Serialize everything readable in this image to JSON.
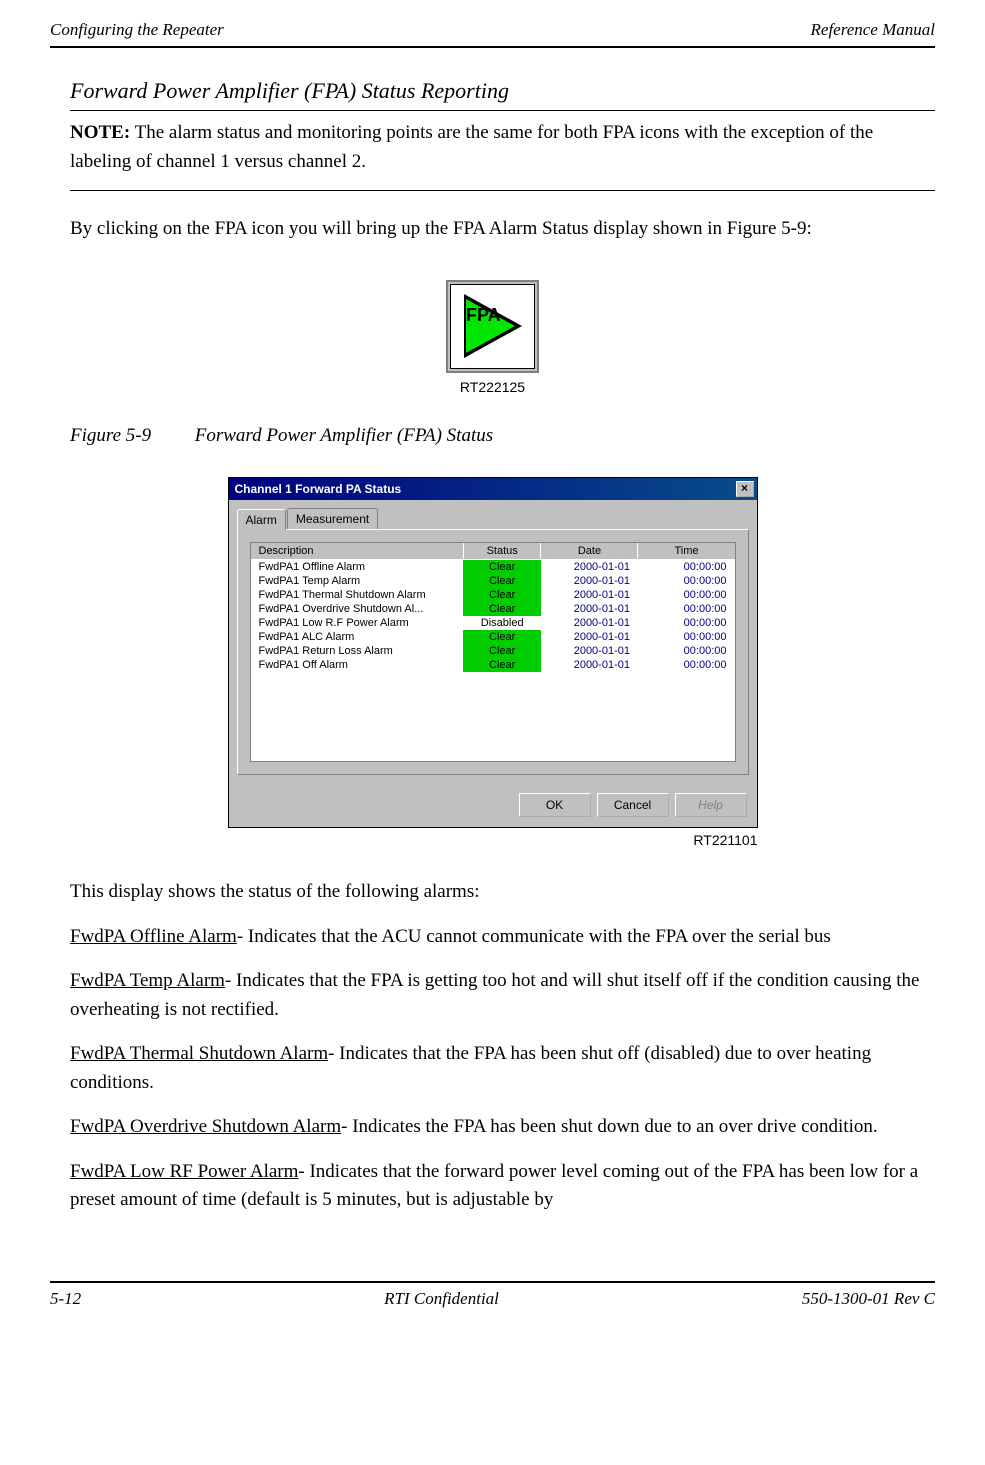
{
  "header": {
    "left": "Configuring the Repeater",
    "right": "Reference Manual"
  },
  "section_title": "Forward Power Amplifier (FPA) Status Reporting",
  "note": {
    "label": "NOTE:",
    "text": "  The alarm status and monitoring points are the same for both FPA icons with the exception of the labeling of channel 1 versus channel 2."
  },
  "intro": "By clicking on the FPA icon you will bring up the FPA Alarm Status display shown in Figure 5-9:",
  "fpa_icon": {
    "label": "FPA",
    "ref": "RT222125"
  },
  "figure": {
    "num": "Figure 5-9",
    "title": "Forward Power Amplifier (FPA) Status"
  },
  "dialog": {
    "title": "Channel 1 Forward PA Status",
    "tabs": {
      "alarm": "Alarm",
      "measurement": "Measurement"
    },
    "headers": {
      "desc": "Description",
      "status": "Status",
      "date": "Date",
      "time": "Time"
    },
    "rows": [
      {
        "desc": "FwdPA1 Offline Alarm",
        "status": "Clear",
        "clear": true,
        "date": "2000-01-01",
        "time": "00:00:00"
      },
      {
        "desc": "FwdPA1 Temp Alarm",
        "status": "Clear",
        "clear": true,
        "date": "2000-01-01",
        "time": "00:00:00"
      },
      {
        "desc": "FwdPA1 Thermal Shutdown Alarm",
        "status": "Clear",
        "clear": true,
        "date": "2000-01-01",
        "time": "00:00:00"
      },
      {
        "desc": "FwdPA1 Overdrive Shutdown Al...",
        "status": "Clear",
        "clear": true,
        "date": "2000-01-01",
        "time": "00:00:00"
      },
      {
        "desc": "FwdPA1 Low R.F Power Alarm",
        "status": "Disabled",
        "clear": false,
        "date": "2000-01-01",
        "time": "00:00:00"
      },
      {
        "desc": "FwdPA1 ALC Alarm",
        "status": "Clear",
        "clear": true,
        "date": "2000-01-01",
        "time": "00:00:00"
      },
      {
        "desc": "FwdPA1 Return Loss Alarm",
        "status": "Clear",
        "clear": true,
        "date": "2000-01-01",
        "time": "00:00:00"
      },
      {
        "desc": "FwdPA1 Off Alarm",
        "status": "Clear",
        "clear": true,
        "date": "2000-01-01",
        "time": "00:00:00"
      }
    ],
    "buttons": {
      "ok": "OK",
      "cancel": "Cancel",
      "help": "Help"
    },
    "ref": "RT221101"
  },
  "status_intro": "This display shows the status of the following alarms:",
  "alarms": [
    {
      "name": "FwdPA Offline Alarm",
      "text": "- Indicates that the ACU cannot communicate with the FPA over the serial bus"
    },
    {
      "name": "FwdPA Temp Alarm",
      "text": "- Indicates that the FPA is getting too hot and will shut itself off if the condition causing the overheating is not rectified."
    },
    {
      "name": "FwdPA Thermal Shutdown Alarm",
      "text": "- Indicates that the FPA has been shut off (disabled) due to over heating conditions."
    },
    {
      "name": "FwdPA Overdrive Shutdown Alarm",
      "text": "- Indicates the FPA has been shut down due to an over drive condition."
    },
    {
      "name": "FwdPA Low RF Power Alarm",
      "text": "- Indicates that the forward power level coming out of the FPA has been low for a preset amount of time (default is 5 minutes, but is adjustable by"
    }
  ],
  "footer": {
    "left": "5-12",
    "center": "RTI Confidential",
    "right": "550-1300-01 Rev C"
  }
}
